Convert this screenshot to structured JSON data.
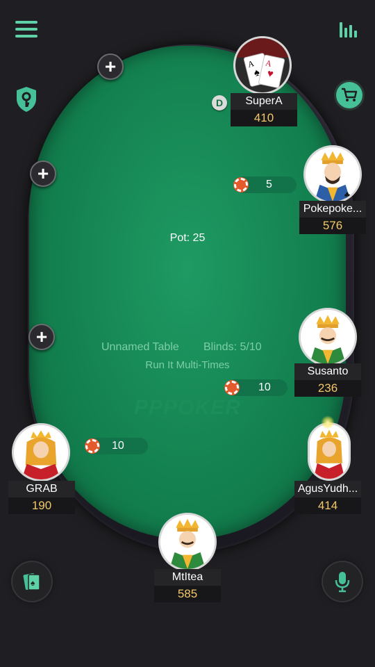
{
  "table": {
    "name": "Unnamed Table",
    "blinds": "Blinds: 5/10",
    "mode": "Run It Multi-Times",
    "pot": "Pot: 25",
    "watermark": "PPPOKER"
  },
  "dealer_label": "D",
  "players": [
    {
      "name": "SuperA",
      "stack": "410",
      "avatar": "pocket-aces"
    },
    {
      "name": "Pokepoke...",
      "stack": "576",
      "avatar": "king-card",
      "bet": "5"
    },
    {
      "name": "Susanto",
      "stack": "236",
      "avatar": "king-card",
      "bet": "10"
    },
    {
      "name": "AgusYudh...",
      "stack": "414",
      "avatar": "queen-card"
    },
    {
      "name": "MtItea",
      "stack": "585",
      "avatar": "king-card"
    },
    {
      "name": "GRAB",
      "stack": "190",
      "avatar": "queen-card",
      "bet": "10"
    }
  ],
  "icons": {
    "menu": "menu-icon",
    "stats": "stats-icon",
    "shield": "shield-key-icon",
    "cart": "cart-icon",
    "cards": "cards-icon",
    "mic": "microphone-icon",
    "add_seat": "plus-icon"
  },
  "colors": {
    "felt": "#13804f",
    "accent": "#5ed1a6",
    "stack": "#f3c868",
    "chip": "#e35a2c"
  }
}
